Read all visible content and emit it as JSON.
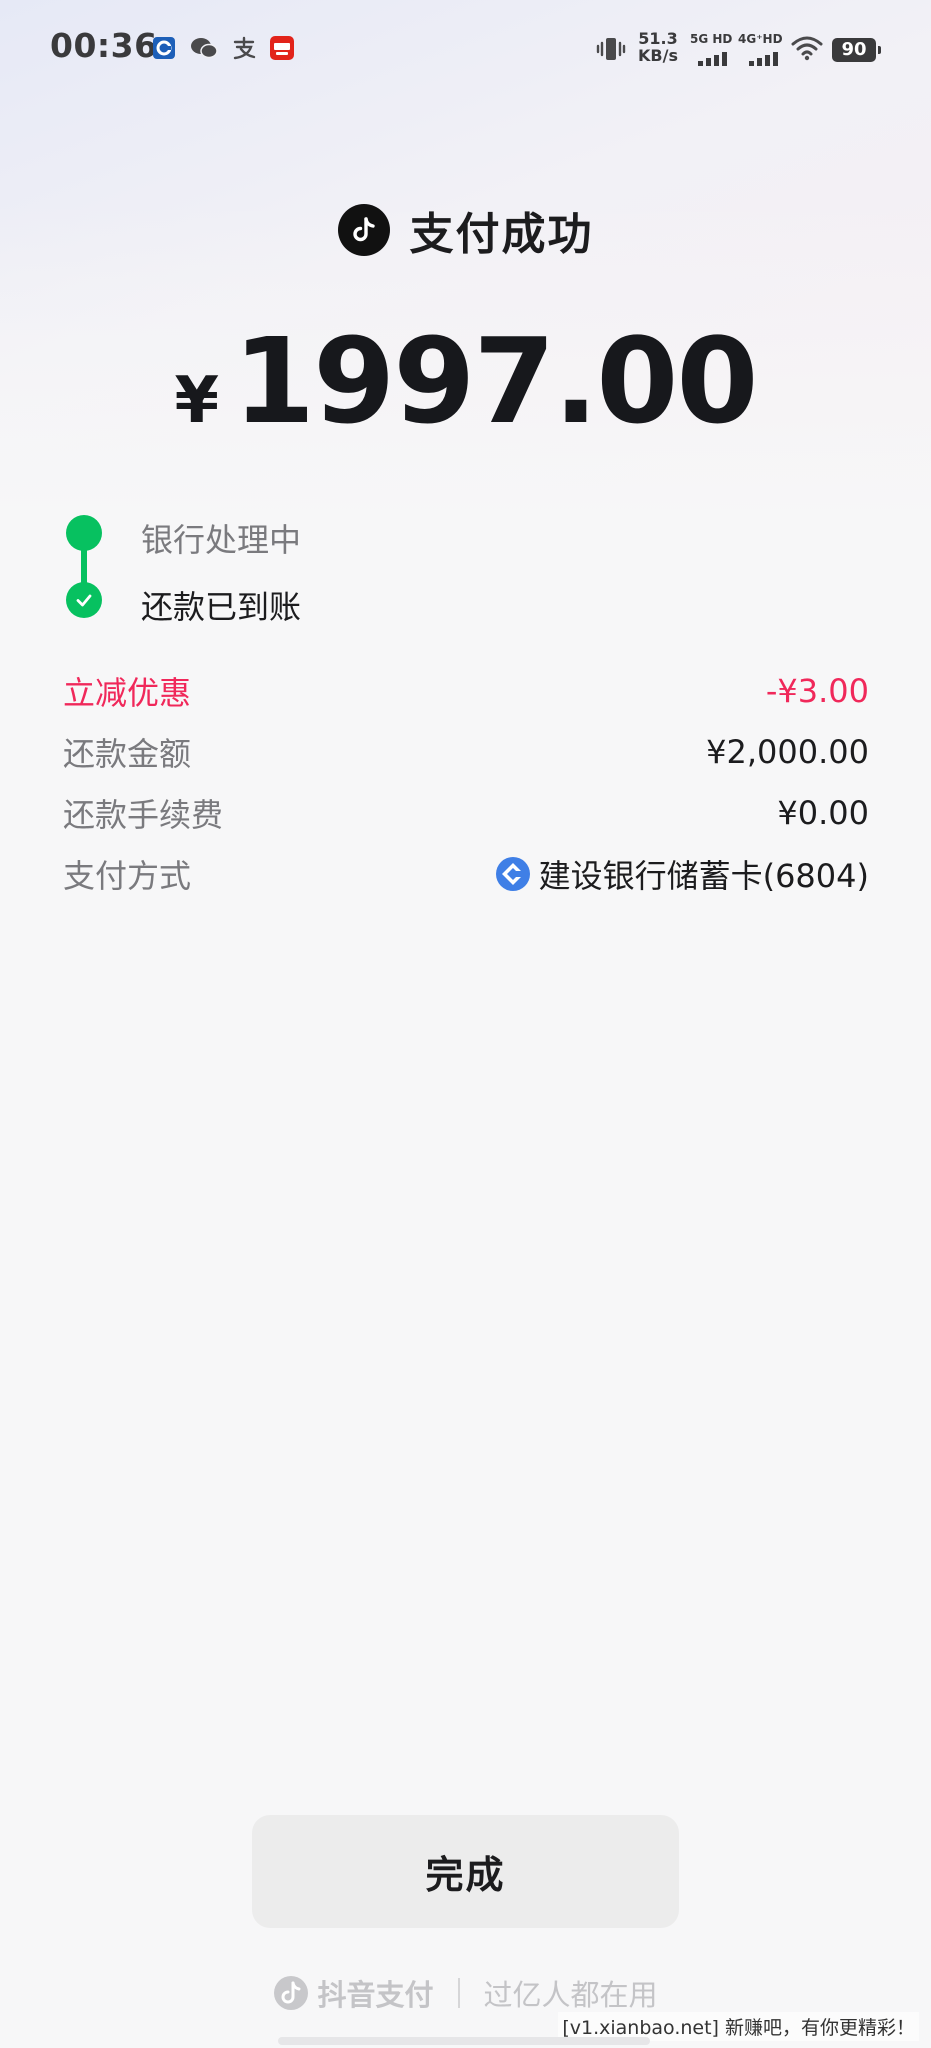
{
  "status_bar": {
    "time": "00:36",
    "net_speed_value": "51.3",
    "net_speed_unit": "KB/s",
    "sim1_label": "5G HD",
    "sim2_label": "4G⁺HD",
    "battery": "90",
    "notification_icons": [
      "ccb-bank-icon",
      "wechat-icon",
      "alipay-icon",
      "app-notification-icon"
    ]
  },
  "header": {
    "title": "支付成功",
    "currency_symbol": "¥",
    "amount": "1997.00"
  },
  "timeline": [
    {
      "label": "银行处理中",
      "state": "done"
    },
    {
      "label": "还款已到账",
      "state": "current"
    }
  ],
  "details": [
    {
      "label": "立减优惠",
      "value": "-¥3.00",
      "highlight": true
    },
    {
      "label": "还款金额",
      "value": "¥2,000.00"
    },
    {
      "label": "还款手续费",
      "value": "¥0.00"
    },
    {
      "label": "支付方式",
      "value": "建设银行储蓄卡(6804)",
      "icon": "ccb-bank-icon"
    }
  ],
  "done_button": "完成",
  "footer": {
    "brand": "抖音支付",
    "slogan": "过亿人都在用"
  },
  "watermark": "[v1.xianbao.net] 新赚吧，有你更精彩！",
  "colors": {
    "success_green": "#07c160",
    "discount_red": "#f0285a",
    "text_primary": "#1c1c1e",
    "text_secondary": "#7a7a7e",
    "ccb_blue": "#3f7fe6"
  }
}
